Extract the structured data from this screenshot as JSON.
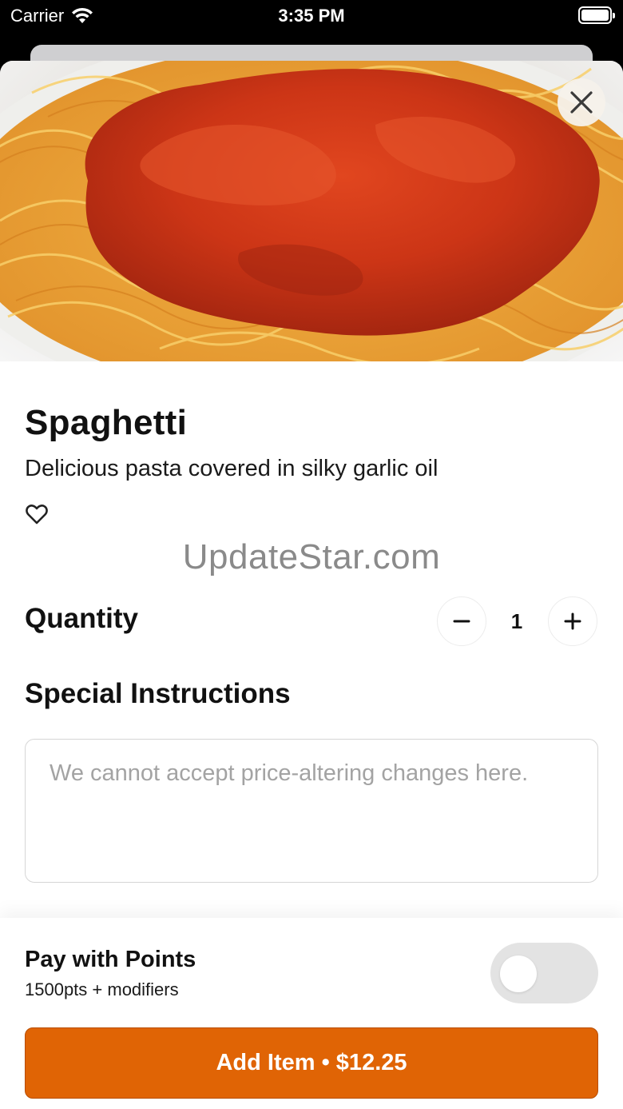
{
  "status_bar": {
    "carrier": "Carrier",
    "time": "3:35 PM"
  },
  "item": {
    "title": "Spaghetti",
    "description": "Delicious pasta covered in silky garlic oil"
  },
  "watermark": "UpdateStar.com",
  "quantity": {
    "label": "Quantity",
    "value": "1"
  },
  "special_instructions": {
    "label": "Special Instructions",
    "placeholder": "We cannot accept price-altering changes here."
  },
  "points": {
    "title": "Pay with Points",
    "subtitle": "1500pts + modifiers",
    "enabled": false
  },
  "add_button": {
    "label": "Add Item • $12.25"
  },
  "colors": {
    "accent": "#e06405",
    "accent_border": "#b84d00",
    "toggle_off": "#e3e3e3"
  },
  "icons": {
    "close": "close-icon",
    "favorite": "heart-outline-icon",
    "decrement": "minus-icon",
    "increment": "plus-icon",
    "wifi": "wifi-icon",
    "battery": "battery-icon"
  }
}
